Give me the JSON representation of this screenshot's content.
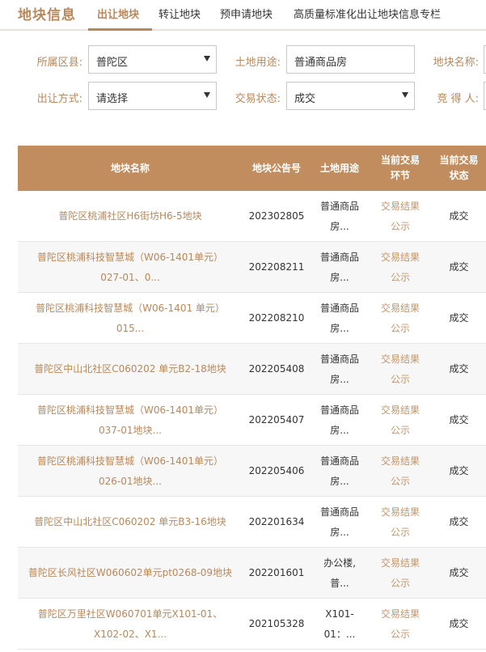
{
  "header": {
    "section_title": "地块信息",
    "tabs": [
      {
        "label": "出让地块",
        "active": true
      },
      {
        "label": "转让地块",
        "active": false
      },
      {
        "label": "预申请地块",
        "active": false
      },
      {
        "label": "高质量标准化出让地块信息专栏",
        "active": false
      }
    ]
  },
  "filters": {
    "district_label": "所属区县:",
    "district_value": "普陀区",
    "land_use_label": "土地用途:",
    "land_use_value": "普通商品房",
    "plot_name_label": "地块名称:",
    "transfer_method_label": "出让方式:",
    "transfer_method_value": "请选择",
    "trade_status_label": "交易状态:",
    "trade_status_value": "成交",
    "winner_label": "竞 得 人:"
  },
  "table": {
    "columns": {
      "name": "地块名称",
      "notice_no": "地块公告号",
      "land_use": "土地用途",
      "stage": [
        "当前交易",
        "环节"
      ],
      "status": [
        "当前交易",
        "状态"
      ]
    },
    "rows": [
      {
        "name": [
          "普陀区桃浦社区H6街坊H6-5地块"
        ],
        "notice_no": "202302805",
        "land_use": [
          "普通商品",
          "房..."
        ],
        "stage": [
          "交易结果",
          "公示"
        ],
        "status": "成交"
      },
      {
        "name": [
          "普陀区桃浦科技智慧城（W06-1401单元）",
          "027-01、0..."
        ],
        "notice_no": "202208211",
        "land_use": [
          "普通商品",
          "房..."
        ],
        "stage": [
          "交易结果",
          "公示"
        ],
        "status": "成交"
      },
      {
        "name": [
          "普陀区桃浦科技智慧城（W06-1401 单元）",
          "015..."
        ],
        "notice_no": "202208210",
        "land_use": [
          "普通商品",
          "房..."
        ],
        "stage": [
          "交易结果",
          "公示"
        ],
        "status": "成交"
      },
      {
        "name": [
          "普陀区中山北社区C060202 单元B2-18地块"
        ],
        "notice_no": "202205408",
        "land_use": [
          "普通商品",
          "房..."
        ],
        "stage": [
          "交易结果",
          "公示"
        ],
        "status": "成交"
      },
      {
        "name": [
          "普陀区桃浦科技智慧城（W06-1401单元）",
          "037-01地块..."
        ],
        "notice_no": "202205407",
        "land_use": [
          "普通商品",
          "房..."
        ],
        "stage": [
          "交易结果",
          "公示"
        ],
        "status": "成交"
      },
      {
        "name": [
          "普陀区桃浦科技智慧城（W06-1401单元）",
          "026-01地块..."
        ],
        "notice_no": "202205406",
        "land_use": [
          "普通商品",
          "房..."
        ],
        "stage": [
          "交易结果",
          "公示"
        ],
        "status": "成交"
      },
      {
        "name": [
          "普陀区中山北社区C060202 单元B3-16地块"
        ],
        "notice_no": "202201634",
        "land_use": [
          "普通商品",
          "房..."
        ],
        "stage": [
          "交易结果",
          "公示"
        ],
        "status": "成交"
      },
      {
        "name": [
          "普陀区长风社区W060602单元pt0268-09地块"
        ],
        "notice_no": "202201601",
        "land_use": [
          "办公楼,",
          "普..."
        ],
        "stage": [
          "交易结果",
          "公示"
        ],
        "status": "成交"
      },
      {
        "name": [
          "普陀区万里社区W060701单元X101-01、",
          "X102-02、X1..."
        ],
        "notice_no": "202105328",
        "land_use": [
          "X101-",
          "01：..."
        ],
        "stage": [
          "交易结果",
          "公示"
        ],
        "status": "成交"
      }
    ]
  }
}
